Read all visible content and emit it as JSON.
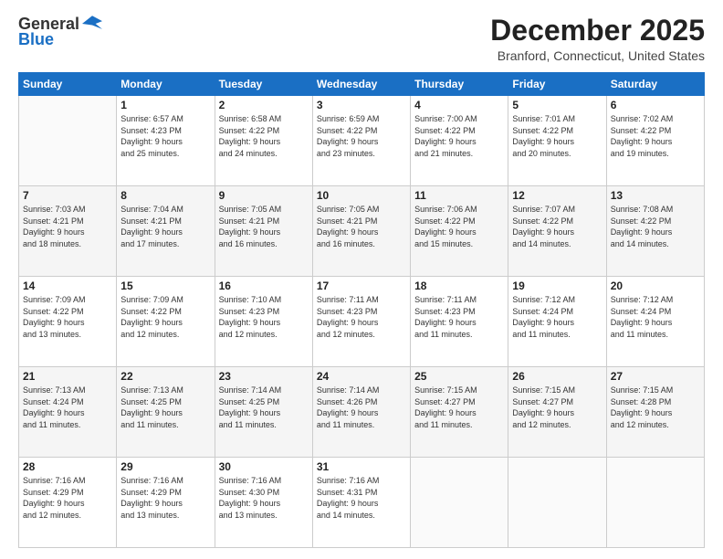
{
  "header": {
    "logo_line1": "General",
    "logo_line2": "Blue",
    "month_title": "December 2025",
    "location": "Branford, Connecticut, United States"
  },
  "days_of_week": [
    "Sunday",
    "Monday",
    "Tuesday",
    "Wednesday",
    "Thursday",
    "Friday",
    "Saturday"
  ],
  "weeks": [
    [
      {
        "day": "",
        "info": ""
      },
      {
        "day": "1",
        "info": "Sunrise: 6:57 AM\nSunset: 4:23 PM\nDaylight: 9 hours\nand 25 minutes."
      },
      {
        "day": "2",
        "info": "Sunrise: 6:58 AM\nSunset: 4:22 PM\nDaylight: 9 hours\nand 24 minutes."
      },
      {
        "day": "3",
        "info": "Sunrise: 6:59 AM\nSunset: 4:22 PM\nDaylight: 9 hours\nand 23 minutes."
      },
      {
        "day": "4",
        "info": "Sunrise: 7:00 AM\nSunset: 4:22 PM\nDaylight: 9 hours\nand 21 minutes."
      },
      {
        "day": "5",
        "info": "Sunrise: 7:01 AM\nSunset: 4:22 PM\nDaylight: 9 hours\nand 20 minutes."
      },
      {
        "day": "6",
        "info": "Sunrise: 7:02 AM\nSunset: 4:22 PM\nDaylight: 9 hours\nand 19 minutes."
      }
    ],
    [
      {
        "day": "7",
        "info": "Sunrise: 7:03 AM\nSunset: 4:21 PM\nDaylight: 9 hours\nand 18 minutes."
      },
      {
        "day": "8",
        "info": "Sunrise: 7:04 AM\nSunset: 4:21 PM\nDaylight: 9 hours\nand 17 minutes."
      },
      {
        "day": "9",
        "info": "Sunrise: 7:05 AM\nSunset: 4:21 PM\nDaylight: 9 hours\nand 16 minutes."
      },
      {
        "day": "10",
        "info": "Sunrise: 7:05 AM\nSunset: 4:21 PM\nDaylight: 9 hours\nand 16 minutes."
      },
      {
        "day": "11",
        "info": "Sunrise: 7:06 AM\nSunset: 4:22 PM\nDaylight: 9 hours\nand 15 minutes."
      },
      {
        "day": "12",
        "info": "Sunrise: 7:07 AM\nSunset: 4:22 PM\nDaylight: 9 hours\nand 14 minutes."
      },
      {
        "day": "13",
        "info": "Sunrise: 7:08 AM\nSunset: 4:22 PM\nDaylight: 9 hours\nand 14 minutes."
      }
    ],
    [
      {
        "day": "14",
        "info": "Sunrise: 7:09 AM\nSunset: 4:22 PM\nDaylight: 9 hours\nand 13 minutes."
      },
      {
        "day": "15",
        "info": "Sunrise: 7:09 AM\nSunset: 4:22 PM\nDaylight: 9 hours\nand 12 minutes."
      },
      {
        "day": "16",
        "info": "Sunrise: 7:10 AM\nSunset: 4:23 PM\nDaylight: 9 hours\nand 12 minutes."
      },
      {
        "day": "17",
        "info": "Sunrise: 7:11 AM\nSunset: 4:23 PM\nDaylight: 9 hours\nand 12 minutes."
      },
      {
        "day": "18",
        "info": "Sunrise: 7:11 AM\nSunset: 4:23 PM\nDaylight: 9 hours\nand 11 minutes."
      },
      {
        "day": "19",
        "info": "Sunrise: 7:12 AM\nSunset: 4:24 PM\nDaylight: 9 hours\nand 11 minutes."
      },
      {
        "day": "20",
        "info": "Sunrise: 7:12 AM\nSunset: 4:24 PM\nDaylight: 9 hours\nand 11 minutes."
      }
    ],
    [
      {
        "day": "21",
        "info": "Sunrise: 7:13 AM\nSunset: 4:24 PM\nDaylight: 9 hours\nand 11 minutes."
      },
      {
        "day": "22",
        "info": "Sunrise: 7:13 AM\nSunset: 4:25 PM\nDaylight: 9 hours\nand 11 minutes."
      },
      {
        "day": "23",
        "info": "Sunrise: 7:14 AM\nSunset: 4:25 PM\nDaylight: 9 hours\nand 11 minutes."
      },
      {
        "day": "24",
        "info": "Sunrise: 7:14 AM\nSunset: 4:26 PM\nDaylight: 9 hours\nand 11 minutes."
      },
      {
        "day": "25",
        "info": "Sunrise: 7:15 AM\nSunset: 4:27 PM\nDaylight: 9 hours\nand 11 minutes."
      },
      {
        "day": "26",
        "info": "Sunrise: 7:15 AM\nSunset: 4:27 PM\nDaylight: 9 hours\nand 12 minutes."
      },
      {
        "day": "27",
        "info": "Sunrise: 7:15 AM\nSunset: 4:28 PM\nDaylight: 9 hours\nand 12 minutes."
      }
    ],
    [
      {
        "day": "28",
        "info": "Sunrise: 7:16 AM\nSunset: 4:29 PM\nDaylight: 9 hours\nand 12 minutes."
      },
      {
        "day": "29",
        "info": "Sunrise: 7:16 AM\nSunset: 4:29 PM\nDaylight: 9 hours\nand 13 minutes."
      },
      {
        "day": "30",
        "info": "Sunrise: 7:16 AM\nSunset: 4:30 PM\nDaylight: 9 hours\nand 13 minutes."
      },
      {
        "day": "31",
        "info": "Sunrise: 7:16 AM\nSunset: 4:31 PM\nDaylight: 9 hours\nand 14 minutes."
      },
      {
        "day": "",
        "info": ""
      },
      {
        "day": "",
        "info": ""
      },
      {
        "day": "",
        "info": ""
      }
    ]
  ]
}
